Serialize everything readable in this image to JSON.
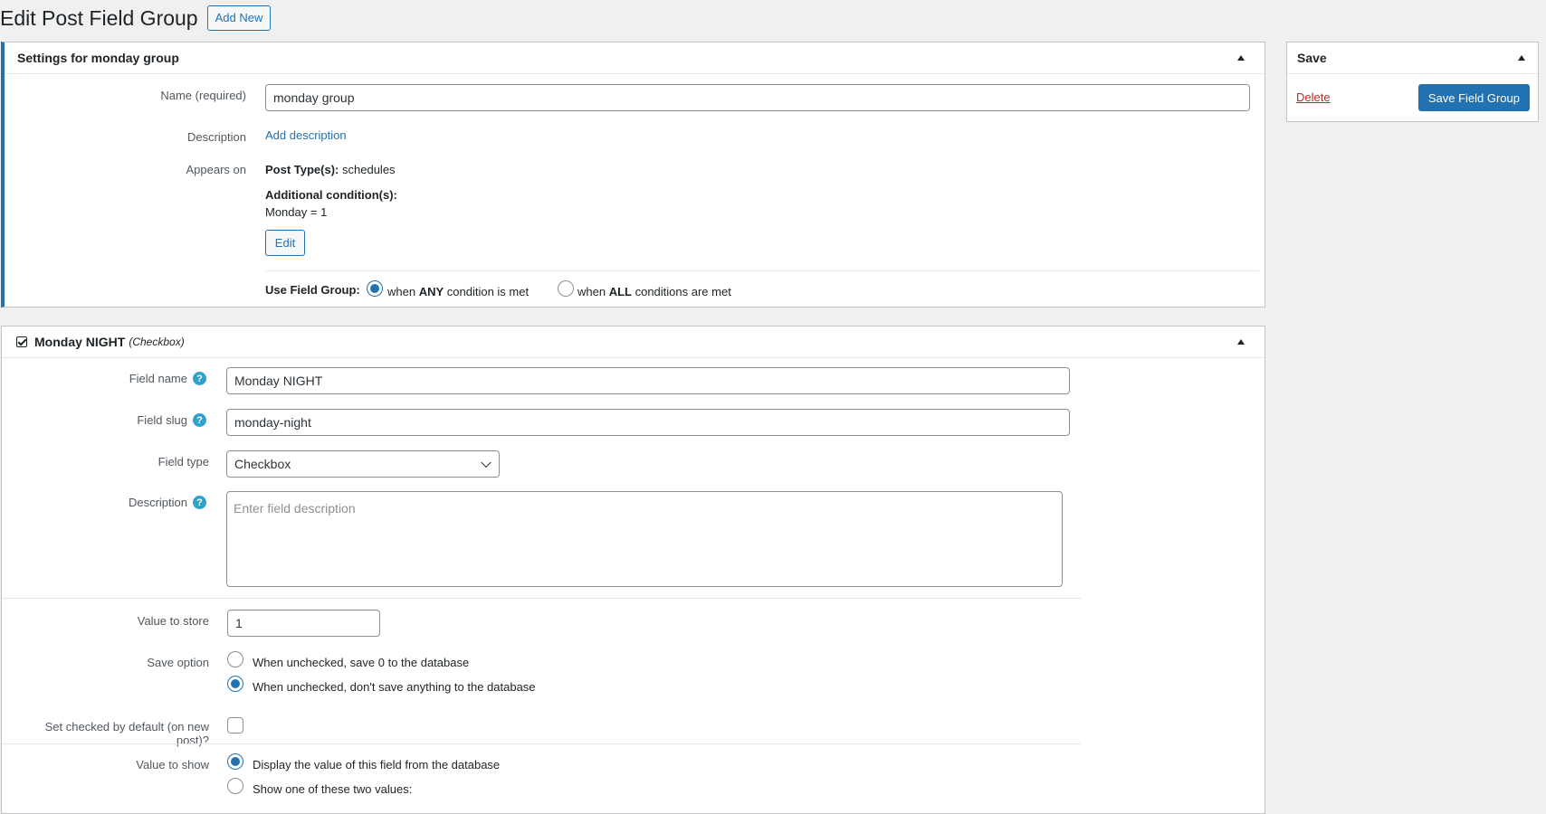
{
  "header": {
    "title": "Edit Post Field Group",
    "add_new_label": "Add New"
  },
  "settings": {
    "title": "Settings for monday group",
    "name_label": "Name (required)",
    "name_value": "monday group",
    "description_label": "Description",
    "add_description_label": "Add description",
    "appears_on_label": "Appears on",
    "post_types_label": "Post Type(s):",
    "post_types_value": "schedules",
    "additional_conditions_label": "Additional condition(s):",
    "condition_value": "Monday = 1",
    "edit_label": "Edit",
    "use_field_group_label": "Use Field Group:",
    "any_option_pre": "when ",
    "any_option_bold": "ANY",
    "any_option_post": " condition is met",
    "all_option_pre": "when ",
    "all_option_bold": "ALL",
    "all_option_post": " conditions are met",
    "selected_condition_mode": "any"
  },
  "save_box": {
    "title": "Save",
    "delete_label": "Delete",
    "save_label": "Save Field Group"
  },
  "field": {
    "title": "Monday NIGHT",
    "type_suffix": "(Checkbox)",
    "field_name_label": "Field name",
    "field_name_value": "Monday NIGHT",
    "field_slug_label": "Field slug",
    "field_slug_value": "monday-night",
    "field_type_label": "Field type",
    "field_type_value": "Checkbox",
    "description_label": "Description",
    "description_placeholder": "Enter field description",
    "value_to_store_label": "Value to store",
    "value_to_store_value": "1",
    "save_option_label": "Save option",
    "save_option_1": "When unchecked, save 0 to the database",
    "save_option_2": "When unchecked, don't save anything to the database",
    "selected_save_option": 2,
    "checked_default_label": "Set checked by default (on new post)?",
    "checked_default_value": false,
    "value_to_show_label": "Value to show",
    "show_option_1": "Display the value of this field from the database",
    "show_option_2": "Show one of these two values:",
    "selected_show_option": 1
  },
  "icons": {
    "help": "help-icon",
    "checkbox": "checkbox-icon",
    "toggle": "triangle-up-icon",
    "select": "chevron-down-icon"
  },
  "colors": {
    "accent": "#2271b1",
    "delete": "#b32d2e",
    "help": "#2ea2cc",
    "background": "#f0f0f1"
  }
}
